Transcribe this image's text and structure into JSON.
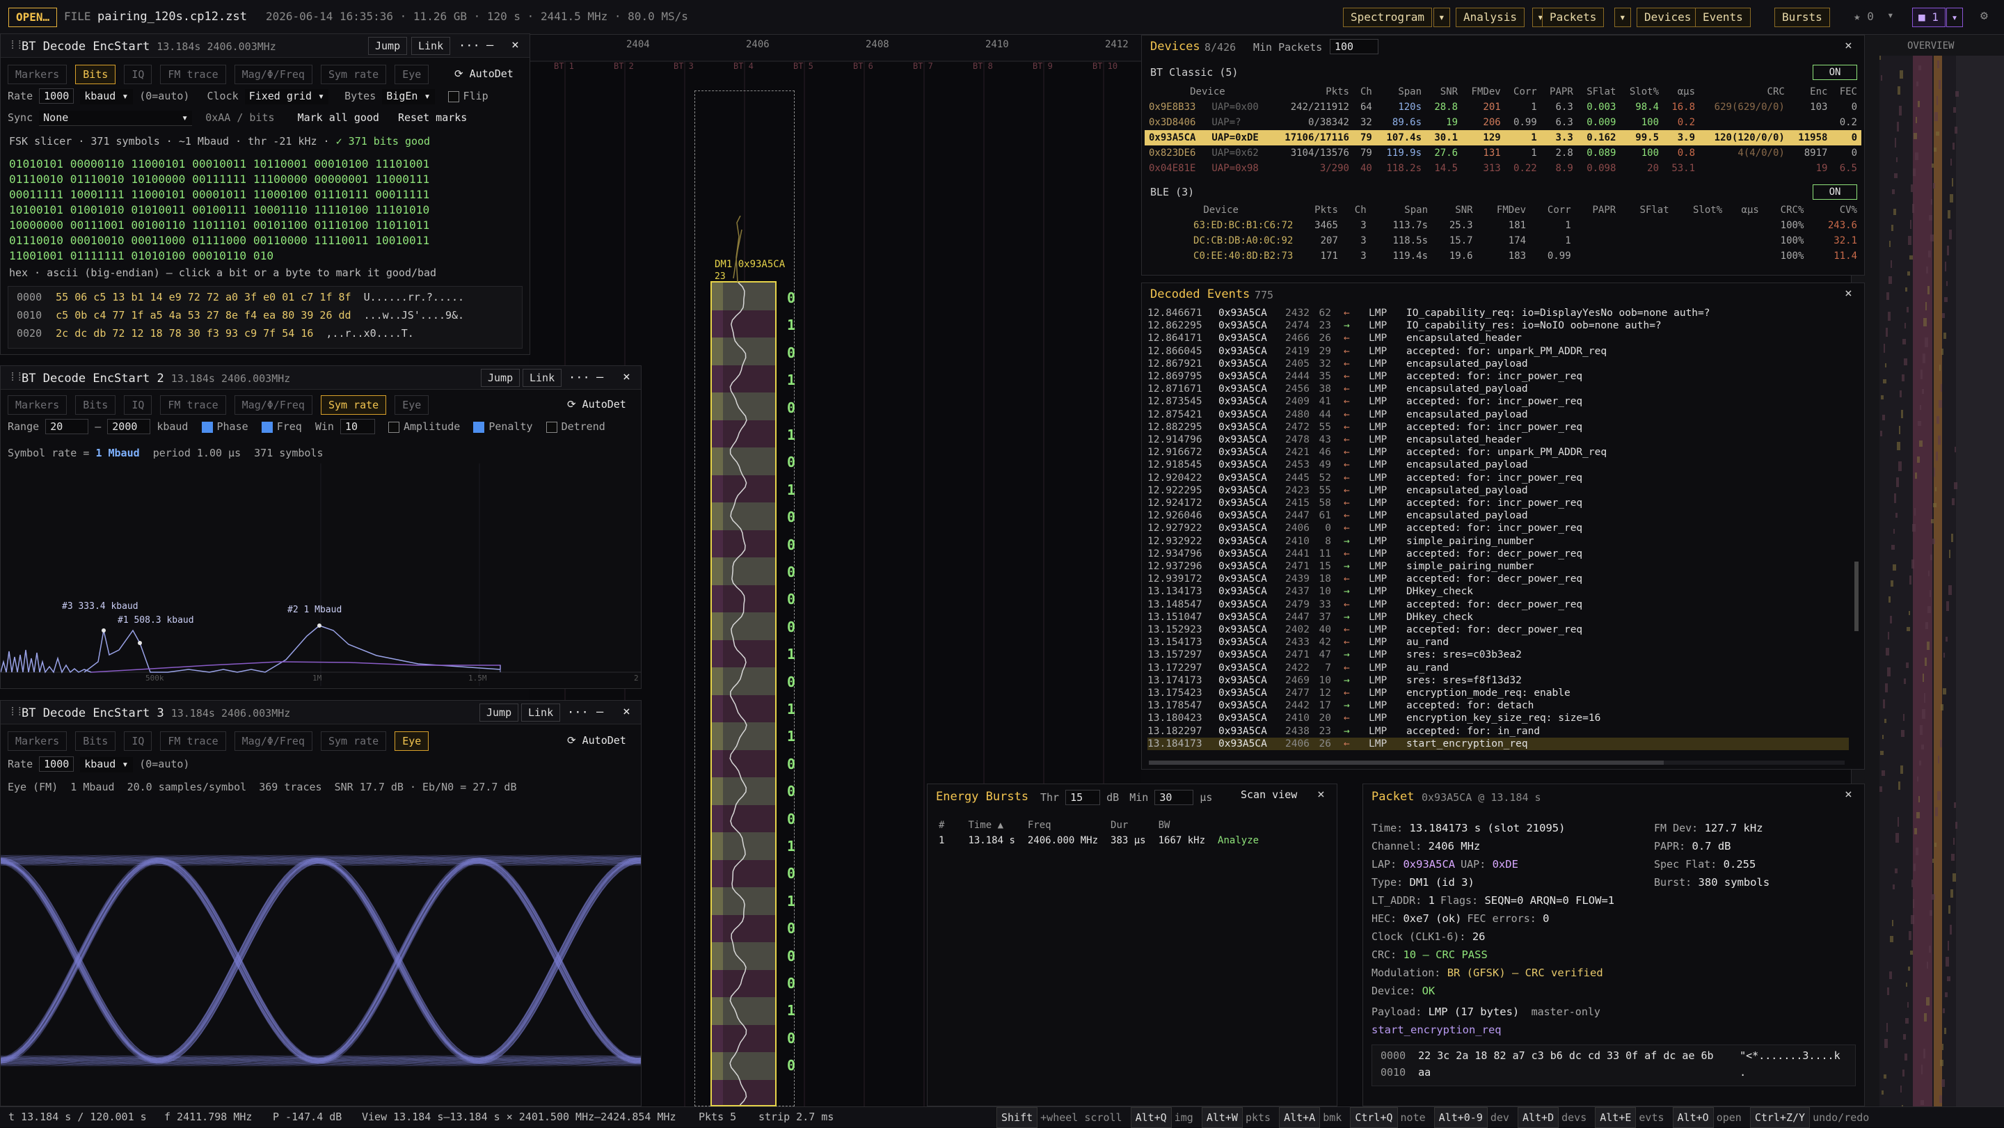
{
  "topbar": {
    "open": "OPEN…",
    "file_label": "FILE",
    "file": "pairing_120s.cp12.zst",
    "meta": "2026-06-14 16:35:36 · 11.26 GB · 120 s · 2441.5 MHz · 80.0 MS/s",
    "menus": [
      "Spectrogram",
      "Analysis",
      "Packets",
      "Devices",
      "Events",
      "Bursts"
    ],
    "star": "★ 0",
    "layers": "1"
  },
  "axis": {
    "ticks": [
      "2404",
      "2406",
      "2408",
      "2410",
      "2412"
    ],
    "channels": [
      "BT 1",
      "BT 2",
      "BT 3",
      "BT 4",
      "BT 5",
      "BT 6",
      "BT 7",
      "BT 8",
      "BT 9",
      "BT 10"
    ],
    "overview": "OVERVIEW"
  },
  "strip": {
    "label1": "DM1 0x93A5CA",
    "label2": "23",
    "bits": [
      "0",
      "1",
      "0",
      "1",
      "0",
      "1",
      "0",
      "1",
      "0",
      "0",
      "0",
      "0",
      "0",
      "1",
      "0",
      "1",
      "1",
      "0",
      "0",
      "0",
      "1",
      "0",
      "1",
      "0",
      "0",
      "0",
      "1",
      "0",
      "0"
    ]
  },
  "p1": {
    "title": "BT Decode EncStart",
    "sub": "13.184s 2406.003MHz",
    "jump": "Jump",
    "link": "Link",
    "more": "···",
    "min": "—",
    "close": "×",
    "tabs": [
      "Markers",
      "Bits",
      "IQ",
      "FM trace",
      "Mag/Φ/Freq",
      "Sym rate",
      "Eye"
    ],
    "active": "Bits",
    "autodet": "AutoDet",
    "rate_lbl": "Rate",
    "rate": "1000",
    "unit": "kbaud",
    "auto": "(0=auto)",
    "clock_lbl": "Clock",
    "clock": "Fixed grid",
    "bytes_lbl": "Bytes",
    "bytes": "BigEn",
    "flip": "Flip",
    "sync_lbl": "Sync",
    "sync": "None",
    "sync_hint": "0xAA / bits",
    "mark_all": "Mark all good",
    "reset": "Reset marks",
    "slicer": "FSK slicer · 371 symbols · ~1 Mbaud · thr -21 kHz ·",
    "good": "✓ 371 bits good",
    "bits": [
      "01010101 00000110 11000101 00010011 10110001 00010100 11101001",
      "01110010 01110010 10100000 00111111 11100000 00000001 11000111",
      "00011111 10001111 11000101 00001011 11000100 01110111 00011111",
      "10100101 01001010 01010011 00100111 10001110 11110100 11101010",
      "10000000 00111001 00100110 11011101 00101100 01110100 11011011",
      "01110010 00010010 00011000 01111000 00110000 11110011 10010011",
      "11001001 01111111 01010100 00010110 010"
    ],
    "hexhint": "hex · ascii (big-endian) — click a bit or a byte to mark it good/bad",
    "hex": [
      {
        "a": "0000",
        "h": "55 06 c5 13 b1 14 e9 72 72 a0 3f e0 01 c7 1f 8f",
        "s": "U......rr.?....."
      },
      {
        "a": "0010",
        "h": "c5 0b c4 77 1f a5 4a 53 27 8e f4 ea 80 39 26 dd",
        "s": "...w..JS'....9&."
      },
      {
        "a": "0020",
        "h": "2c dc db 72 12 18 78 30 f3 93 c9 7f 54 16",
        "s": ",..r..x0....T."
      }
    ]
  },
  "p2": {
    "title": "BT Decode EncStart 2",
    "sub": "13.184s 2406.003MHz",
    "jump": "Jump",
    "link": "Link",
    "more": "···",
    "min": "—",
    "close": "×",
    "tabs": [
      "Markers",
      "Bits",
      "IQ",
      "FM trace",
      "Mag/Φ/Freq",
      "Sym rate",
      "Eye"
    ],
    "active": "Sym rate",
    "autodet": "AutoDet",
    "range_lbl": "Range",
    "lo": "20",
    "dash": "–",
    "hi": "2000",
    "unit": "kbaud",
    "phase": "Phase",
    "freq": "Freq",
    "win_lbl": "Win",
    "win": "10",
    "amp": "Amplitude",
    "pen": "Penalty",
    "detrend": "Detrend",
    "symrate_lbl": "Symbol rate =",
    "symrate": "1 Mbaud",
    "period": "period 1.00 µs",
    "count": "371 symbols",
    "peaks": [
      "#3 333.4 kbaud",
      "#1 508.3 kbaud",
      "#2 1 Mbaud"
    ],
    "xticks": [
      "500k",
      "1M",
      "1.5M",
      "2"
    ]
  },
  "p3": {
    "title": "BT Decode EncStart 3",
    "sub": "13.184s 2406.003MHz",
    "jump": "Jump",
    "link": "Link",
    "more": "···",
    "min": "—",
    "close": "×",
    "tabs": [
      "Markers",
      "Bits",
      "IQ",
      "FM trace",
      "Mag/Φ/Freq",
      "Sym rate",
      "Eye"
    ],
    "active": "Eye",
    "autodet": "AutoDet",
    "rate_lbl": "Rate",
    "rate": "1000",
    "unit": "kbaud",
    "auto": "(0=auto)",
    "info": "Eye (FM)  1 Mbaud  20.0 samples/symbol  369 traces  SNR 17.7 dB · Eb/N0 = 27.7 dB"
  },
  "devices": {
    "title": "Devices",
    "count": "8/426",
    "minpk_lbl": "Min Packets",
    "minpk": "100",
    "close": "×",
    "classic": {
      "label": "BT Classic (5)",
      "on": "ON",
      "cols": [
        "Device",
        "Pkts",
        "Ch",
        "Span",
        "SNR",
        "FMDev",
        "Corr",
        "PAPR",
        "SFlat",
        "Slot%",
        "αµs",
        "CRC",
        "Enc",
        "FEC"
      ],
      "rows": [
        [
          "0x9E8B33",
          "UAP=0x00",
          "242/211912",
          "64",
          "120s",
          "28.8",
          "201",
          "1",
          "6.3",
          "0.003",
          "98.4",
          "16.8",
          "629(629/0/0)",
          "103",
          "0"
        ],
        [
          "0x3D8406",
          "UAP=?",
          "0/38342",
          "32",
          "89.6s",
          "19",
          "206",
          "0.99",
          "6.3",
          "0.009",
          "100",
          "0.2",
          "",
          "",
          "0.2"
        ],
        [
          "0x93A5CA",
          "UAP=0xDE",
          "17106/17116",
          "79",
          "107.4s",
          "30.1",
          "129",
          "1",
          "3.3",
          "0.162",
          "99.5",
          "3.9",
          "120(120/0/0)",
          "11958",
          "0"
        ],
        [
          "0x823DE6",
          "UAP=0x62",
          "3104/13576",
          "79",
          "119.9s",
          "27.6",
          "131",
          "1",
          "2.8",
          "0.089",
          "100",
          "0.8",
          "4(4/0/0)",
          "8917",
          "0"
        ],
        [
          "0x04E81E",
          "UAP=0x98",
          "3/290",
          "40",
          "118.2s",
          "14.5",
          "313",
          "0.22",
          "8.9",
          "0.098",
          "20",
          "53.1",
          "",
          "19",
          "6.5"
        ]
      ]
    },
    "ble": {
      "label": "BLE (3)",
      "on": "ON",
      "cols": [
        "Device",
        "Pkts",
        "Ch",
        "Span",
        "SNR",
        "FMDev",
        "Corr",
        "PAPR",
        "SFlat",
        "Slot%",
        "αµs",
        "CRC%",
        "CV%"
      ],
      "rows": [
        [
          "63:ED:BC:B1:C6:72",
          "3465",
          "3",
          "113.7s",
          "25.3",
          "181",
          "1",
          "",
          "",
          "",
          "",
          "100%",
          "243.6"
        ],
        [
          "DC:CB:DB:A0:0C:92",
          "207",
          "3",
          "118.5s",
          "15.7",
          "174",
          "1",
          "",
          "",
          "",
          "",
          "100%",
          "32.1"
        ],
        [
          "C0:EE:40:8D:B2:73",
          "171",
          "3",
          "119.4s",
          "19.6",
          "183",
          "0.99",
          "",
          "",
          "",
          "",
          "100%",
          "11.4"
        ]
      ]
    }
  },
  "events": {
    "title": "Decoded Events",
    "count": "775",
    "close": "×",
    "rows": [
      [
        "12.846671",
        "0x93A5CA",
        "2432",
        "62",
        "←",
        "LMP",
        "IO_capability_req: io=DisplayYesNo oob=none auth=?"
      ],
      [
        "12.862295",
        "0x93A5CA",
        "2474",
        "23",
        "→",
        "LMP",
        "IO_capability_res: io=NoIO oob=none auth=?"
      ],
      [
        "12.864171",
        "0x93A5CA",
        "2466",
        "26",
        "←",
        "LMP",
        "encapsulated_header"
      ],
      [
        "12.866045",
        "0x93A5CA",
        "2419",
        "29",
        "←",
        "LMP",
        "accepted: for: unpark_PM_ADDR_req"
      ],
      [
        "12.867921",
        "0x93A5CA",
        "2405",
        "32",
        "←",
        "LMP",
        "encapsulated_payload"
      ],
      [
        "12.869795",
        "0x93A5CA",
        "2444",
        "35",
        "←",
        "LMP",
        "accepted: for: incr_power_req"
      ],
      [
        "12.871671",
        "0x93A5CA",
        "2456",
        "38",
        "←",
        "LMP",
        "encapsulated_payload"
      ],
      [
        "12.873545",
        "0x93A5CA",
        "2409",
        "41",
        "←",
        "LMP",
        "accepted: for: incr_power_req"
      ],
      [
        "12.875421",
        "0x93A5CA",
        "2480",
        "44",
        "←",
        "LMP",
        "encapsulated_payload"
      ],
      [
        "12.882295",
        "0x93A5CA",
        "2472",
        "55",
        "←",
        "LMP",
        "accepted: for: incr_power_req"
      ],
      [
        "12.914796",
        "0x93A5CA",
        "2478",
        "43",
        "←",
        "LMP",
        "encapsulated_header"
      ],
      [
        "12.916672",
        "0x93A5CA",
        "2421",
        "46",
        "←",
        "LMP",
        "accepted: for: unpark_PM_ADDR_req"
      ],
      [
        "12.918545",
        "0x93A5CA",
        "2453",
        "49",
        "←",
        "LMP",
        "encapsulated_payload"
      ],
      [
        "12.920422",
        "0x93A5CA",
        "2445",
        "52",
        "←",
        "LMP",
        "accepted: for: incr_power_req"
      ],
      [
        "12.922295",
        "0x93A5CA",
        "2423",
        "55",
        "←",
        "LMP",
        "encapsulated_payload"
      ],
      [
        "12.924172",
        "0x93A5CA",
        "2415",
        "58",
        "←",
        "LMP",
        "accepted: for: incr_power_req"
      ],
      [
        "12.926046",
        "0x93A5CA",
        "2447",
        "61",
        "←",
        "LMP",
        "encapsulated_payload"
      ],
      [
        "12.927922",
        "0x93A5CA",
        "2406",
        "0",
        "←",
        "LMP",
        "accepted: for: incr_power_req"
      ],
      [
        "12.932922",
        "0x93A5CA",
        "2410",
        "8",
        "→",
        "LMP",
        "simple_pairing_number"
      ],
      [
        "12.934796",
        "0x93A5CA",
        "2441",
        "11",
        "←",
        "LMP",
        "accepted: for: decr_power_req"
      ],
      [
        "12.937296",
        "0x93A5CA",
        "2471",
        "15",
        "→",
        "LMP",
        "simple_pairing_number"
      ],
      [
        "12.939172",
        "0x93A5CA",
        "2439",
        "18",
        "←",
        "LMP",
        "accepted: for: decr_power_req"
      ],
      [
        "13.134173",
        "0x93A5CA",
        "2437",
        "10",
        "→",
        "LMP",
        "DHkey_check"
      ],
      [
        "13.148547",
        "0x93A5CA",
        "2479",
        "33",
        "←",
        "LMP",
        "accepted: for: decr_power_req"
      ],
      [
        "13.151047",
        "0x93A5CA",
        "2447",
        "37",
        "→",
        "LMP",
        "DHkey_check"
      ],
      [
        "13.152923",
        "0x93A5CA",
        "2402",
        "40",
        "←",
        "LMP",
        "accepted: for: decr_power_req"
      ],
      [
        "13.154173",
        "0x93A5CA",
        "2433",
        "42",
        "←",
        "LMP",
        "au_rand"
      ],
      [
        "13.157297",
        "0x93A5CA",
        "2471",
        "47",
        "→",
        "LMP",
        "sres: sres=c03b3ea2"
      ],
      [
        "13.172297",
        "0x93A5CA",
        "2422",
        "7",
        "←",
        "LMP",
        "au_rand"
      ],
      [
        "13.174173",
        "0x93A5CA",
        "2469",
        "10",
        "→",
        "LMP",
        "sres: sres=f8f13d32"
      ],
      [
        "13.175423",
        "0x93A5CA",
        "2477",
        "12",
        "←",
        "LMP",
        "encryption_mode_req: enable"
      ],
      [
        "13.178547",
        "0x93A5CA",
        "2442",
        "17",
        "→",
        "LMP",
        "accepted: for: detach"
      ],
      [
        "13.180423",
        "0x93A5CA",
        "2410",
        "20",
        "←",
        "LMP",
        "encryption_key_size_req: size=16"
      ],
      [
        "13.182297",
        "0x93A5CA",
        "2438",
        "23",
        "→",
        "LMP",
        "accepted: for: in_rand"
      ],
      [
        "13.184173",
        "0x93A5CA",
        "2406",
        "26",
        "←",
        "LMP",
        "start_encryption_req"
      ]
    ]
  },
  "bursts": {
    "title": "Energy Bursts",
    "thr_lbl": "Thr",
    "thr": "15",
    "db": "dB",
    "min_lbl": "Min",
    "min": "30",
    "us": "µs",
    "scan": "Scan view",
    "close": "×",
    "cols": [
      "#",
      "Time ▲",
      "Freq",
      "Dur",
      "BW"
    ],
    "rows": [
      [
        "1",
        "13.184 s",
        "2406.000 MHz",
        "383 µs",
        "1667 kHz",
        "Analyze"
      ]
    ]
  },
  "packet": {
    "title": "Packet",
    "sub": "0x93A5CA @ 13.184 s",
    "close": "×",
    "left": [
      [
        "Time:",
        "13.184173 s (slot 21095)"
      ],
      [
        "Channel:",
        "2406 MHz"
      ],
      [
        "LAP:",
        "0x93A5CA",
        "UAP:",
        "0xDE"
      ],
      [
        "Type:",
        "DM1 (id 3)"
      ],
      [
        "LT_ADDR:",
        "1",
        "Flags:",
        "SEQN=0 ARQN=0 FLOW=1"
      ],
      [
        "HEC:",
        "0xe7 (ok)",
        "FEC errors:",
        "0"
      ],
      [
        "Clock (CLK1-6):",
        "26"
      ],
      [
        "CRC:",
        "10 — CRC PASS"
      ],
      [
        "Modulation:",
        "BR (GFSK) — CRC verified"
      ],
      [
        "Device:",
        "OK"
      ]
    ],
    "right": [
      [
        "FM Dev:",
        "127.7 kHz"
      ],
      [
        "PAPR:",
        "0.7 dB"
      ],
      [
        "Spec Flat:",
        "0.255"
      ],
      [
        "Burst:",
        "380 symbols"
      ]
    ],
    "payload_lbl": "Payload:",
    "payload": "LMP (17 bytes)",
    "payload_note": "master-only",
    "opcode": "start_encryption_req",
    "hex": [
      {
        "a": "0000",
        "h": "22 3c 2a 18 82 a7 c3 b6 dc cd 33 0f af dc ae 6b",
        "s": "\"<*.......3....k"
      },
      {
        "a": "0010",
        "h": "aa",
        "s": "."
      }
    ]
  },
  "status": {
    "t": "t 13.184 s / 120.001 s",
    "f": "f 2411.798 MHz",
    "p": "P -147.4 dB",
    "view": "View 13.184 s–13.184 s × 2401.500 MHz–2424.854 MHz",
    "pkts": "Pkts 5",
    "strip": "strip 2.7 ms",
    "keys": [
      [
        "Shift",
        "+wheel scroll"
      ],
      [
        "Alt+Q",
        "img"
      ],
      [
        "Alt+W",
        "pkts"
      ],
      [
        "Alt+A",
        "bmk"
      ],
      [
        "Ctrl+Q",
        "note"
      ],
      [
        "Alt+0-9",
        "dev"
      ],
      [
        "Alt+D",
        "devs"
      ],
      [
        "Alt+E",
        "evts"
      ],
      [
        "Alt+O",
        "open"
      ],
      [
        "Ctrl+Z/Y",
        "undo/redo"
      ]
    ]
  }
}
